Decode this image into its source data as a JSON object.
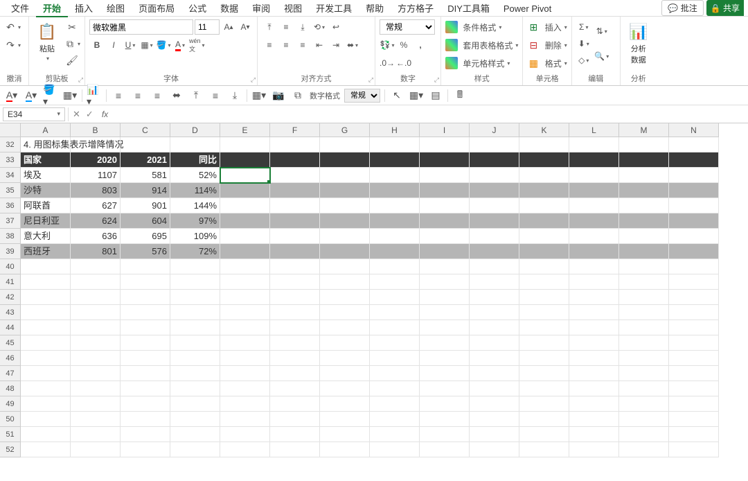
{
  "menu": {
    "tabs": [
      "文件",
      "开始",
      "插入",
      "绘图",
      "页面布局",
      "公式",
      "数据",
      "审阅",
      "视图",
      "开发工具",
      "帮助",
      "方方格子",
      "DIY工具箱",
      "Power Pivot"
    ],
    "active": 1,
    "comment": "批注",
    "share": "共享"
  },
  "ribbon": {
    "undo": "撤消",
    "clipboard": {
      "label": "剪贴板",
      "paste": "粘贴"
    },
    "font": {
      "label": "字体",
      "name": "微软雅黑",
      "size": "11",
      "bold": "B",
      "italic": "I",
      "underline": "U"
    },
    "align": {
      "label": "对齐方式"
    },
    "number": {
      "label": "数字",
      "format": "常规",
      "percent": "%"
    },
    "styles": {
      "label": "样式",
      "cond": "条件格式",
      "table": "套用表格格式",
      "cell": "单元格样式"
    },
    "cells": {
      "label": "单元格",
      "insert": "插入",
      "delete": "删除",
      "format": "格式"
    },
    "editing": {
      "label": "编辑"
    },
    "analysis": {
      "label": "分析",
      "btn": "分析\n数据"
    }
  },
  "quickbar": {
    "numfmt_label": "数字格式",
    "numfmt": "常规"
  },
  "formula": {
    "cellref": "E34",
    "fx": "fx"
  },
  "sheet": {
    "cols": [
      "A",
      "B",
      "C",
      "D",
      "E",
      "F",
      "G",
      "H",
      "I",
      "J",
      "K",
      "L",
      "M",
      "N"
    ],
    "startRow": 32,
    "rowCount": 21,
    "title": "4. 用图标集表示增降情况",
    "headers": [
      "国家",
      "2020",
      "2021",
      "同比"
    ],
    "rows": [
      {
        "c": "埃及",
        "a": "1107",
        "b": "581",
        "p": "52%",
        "alt": false
      },
      {
        "c": "沙特",
        "a": "803",
        "b": "914",
        "p": "114%",
        "alt": true
      },
      {
        "c": "阿联酋",
        "a": "627",
        "b": "901",
        "p": "144%",
        "alt": false
      },
      {
        "c": "尼日利亚",
        "a": "624",
        "b": "604",
        "p": "97%",
        "alt": true
      },
      {
        "c": "意大利",
        "a": "636",
        "b": "695",
        "p": "109%",
        "alt": false
      },
      {
        "c": "西班牙",
        "a": "801",
        "b": "576",
        "p": "72%",
        "alt": true
      }
    ],
    "selected": {
      "row": 34,
      "col": "E"
    }
  }
}
